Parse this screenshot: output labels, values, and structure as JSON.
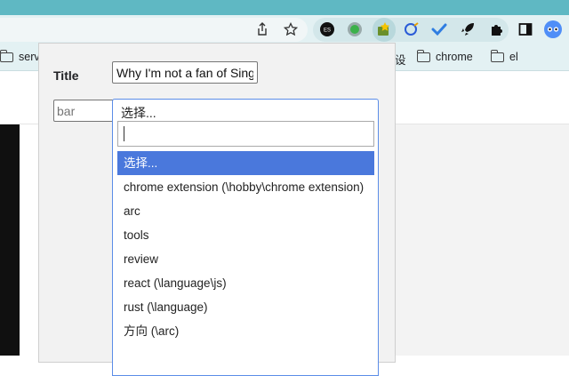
{
  "colors": {
    "accent_strip": "#5fb8c3",
    "toolbar_bg": "#e3f1f3",
    "selected_option": "#4a78dc",
    "select_border": "#5b8de8"
  },
  "browser": {
    "toolbar_icons": [
      "share-icon",
      "star-icon"
    ],
    "extensions": [
      {
        "name": "es-extension-icon",
        "label": "ES"
      },
      {
        "name": "green-dot-extension-icon"
      },
      {
        "name": "puzzle-star-extension-icon"
      },
      {
        "name": "stylus-extension-icon"
      },
      {
        "name": "check-extension-icon"
      },
      {
        "name": "rocket-extension-icon"
      },
      {
        "name": "puzzle-extensions-icon"
      },
      {
        "name": "sidebar-icon"
      },
      {
        "name": "profile-avatar-icon"
      }
    ],
    "bookmarks": [
      {
        "label": "serv"
      },
      {
        "label": "设"
      },
      {
        "label": "chrome"
      },
      {
        "label": "el"
      }
    ]
  },
  "popup": {
    "title_label": "Title",
    "title_value": "Why I'm not a fan of Sing",
    "tag_placeholder": "bar",
    "select_value": "选择...",
    "search_value": "",
    "options": [
      {
        "label": "选择...",
        "selected": true
      },
      {
        "label": "chrome extension (\\hobby\\chrome extension)",
        "selected": false
      },
      {
        "label": "arc",
        "selected": false
      },
      {
        "label": "tools",
        "selected": false
      },
      {
        "label": "review",
        "selected": false
      },
      {
        "label": "react (\\language\\js)",
        "selected": false
      },
      {
        "label": "rust (\\language)",
        "selected": false
      },
      {
        "label": "方向 (\\arc)",
        "selected": false
      }
    ]
  }
}
